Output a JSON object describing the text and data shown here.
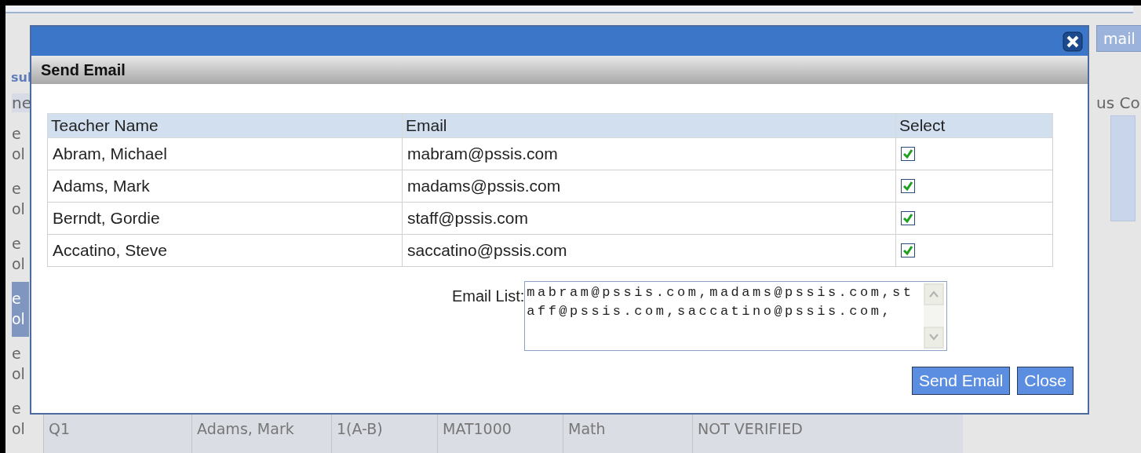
{
  "background": {
    "section_title": "sul",
    "column_header": "ne",
    "right_column_header": "us Co",
    "email_button": "mail",
    "side_cells": [
      {
        "text": "e ol",
        "selected": false
      },
      {
        "text": "e ol",
        "selected": false
      },
      {
        "text": "e ol",
        "selected": false
      },
      {
        "text": "e ol",
        "selected": true
      },
      {
        "text": "e ol",
        "selected": false
      },
      {
        "text": "e ol",
        "selected": false
      }
    ],
    "bottom_row": [
      "Q1",
      "Adams, Mark",
      "1(A-B)",
      "MAT1000",
      "Math",
      "NOT VERIFIED"
    ]
  },
  "dialog": {
    "title": "Send Email",
    "table": {
      "columns": [
        "Teacher Name",
        "Email",
        "Select"
      ],
      "rows": [
        {
          "name": "Abram, Michael",
          "email": "mabram@pssis.com",
          "checked": true
        },
        {
          "name": "Adams, Mark",
          "email": "madams@pssis.com",
          "checked": true
        },
        {
          "name": "Berndt, Gordie",
          "email": "staff@pssis.com",
          "checked": true
        },
        {
          "name": "Accatino, Steve",
          "email": "saccatino@pssis.com",
          "checked": true
        }
      ]
    },
    "email_list": {
      "label": "Email List:",
      "value": "mabram@pssis.com,madams@pssis.com,staff@pssis.com,saccatino@pssis.com,"
    },
    "buttons": [
      "Send Email",
      "Close"
    ]
  }
}
